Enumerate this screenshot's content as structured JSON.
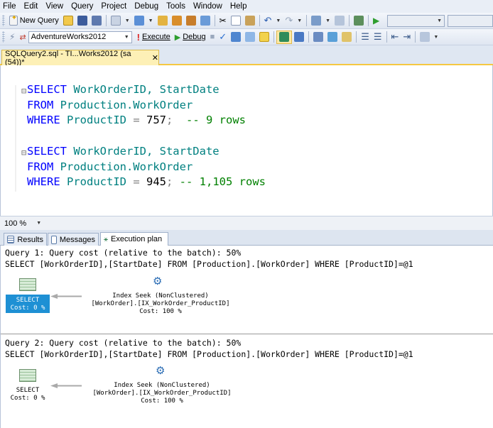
{
  "menu": [
    "File",
    "Edit",
    "View",
    "Query",
    "Project",
    "Debug",
    "Tools",
    "Window",
    "Help"
  ],
  "toolbar1": {
    "new_query": "New Query"
  },
  "toolbar2": {
    "database": "AdventureWorks2012",
    "execute": "Execute",
    "debug": "Debug"
  },
  "doc_tab": {
    "title": "SQLQuery2.sql - TI...Works2012 (sa (54))*",
    "close": "✕"
  },
  "editor": {
    "q1": {
      "l1_kw": "SELECT",
      "l1_cols": " WorkOrderID, StartDate",
      "l2_kw": "FROM",
      "l2_tbl": " Production.WorkOrder",
      "l3_kw": "WHERE",
      "l3_col": " ProductID",
      "l3_eq": " = ",
      "l3_val": "757",
      "l3_semi": ";",
      "l3_comment": "  -- 9 rows"
    },
    "q2": {
      "l1_kw": "SELECT",
      "l1_cols": " WorkOrderID, StartDate",
      "l2_kw": "FROM",
      "l2_tbl": " Production.WorkOrder",
      "l3_kw": "WHERE",
      "l3_col": " ProductID",
      "l3_eq": " = ",
      "l3_val": "945",
      "l3_semi": ";",
      "l3_comment": " -- 1,105 rows"
    }
  },
  "zoom": "100 %",
  "result_tabs": [
    "Results",
    "Messages",
    "Execution plan"
  ],
  "plan": {
    "q1": {
      "header": "Query 1: Query cost (relative to the batch): 50%",
      "sql": "SELECT [WorkOrderID],[StartDate] FROM [Production].[WorkOrder] WHERE [ProductID]=@1",
      "select_label": "SELECT",
      "select_cost": "Cost: 0 %",
      "op_name": "Index Seek (NonClustered)",
      "op_object": "[WorkOrder].[IX_WorkOrder_ProductID]",
      "op_cost": "Cost: 100 %"
    },
    "q2": {
      "header": "Query 2: Query cost (relative to the batch): 50%",
      "sql": "SELECT [WorkOrderID],[StartDate] FROM [Production].[WorkOrder] WHERE [ProductID]=@1",
      "select_label": "SELECT",
      "select_cost": "Cost: 0 %",
      "op_name": "Index Seek (NonClustered)",
      "op_object": "[WorkOrder].[IX_WorkOrder_ProductID]",
      "op_cost": "Cost: 100 %"
    }
  }
}
